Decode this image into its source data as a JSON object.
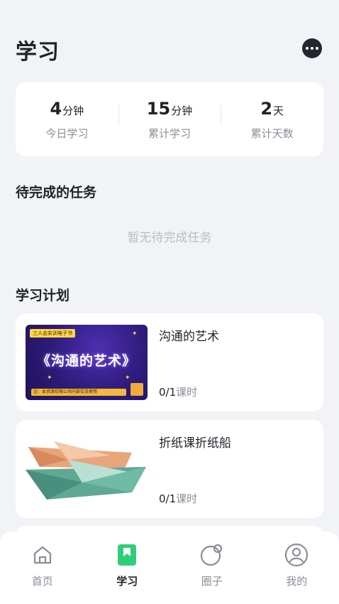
{
  "header": {
    "title": "学习"
  },
  "stats": [
    {
      "value": "4",
      "unit": "分钟",
      "label": "今日学习"
    },
    {
      "value": "15",
      "unit": "分钟",
      "label": "累计学习"
    },
    {
      "value": "2",
      "unit": "天",
      "label": "累计天数"
    }
  ],
  "tasks": {
    "title": "待完成的任务",
    "empty_text": "暂无待完成任务"
  },
  "plan": {
    "title": "学习计划",
    "courses": [
      {
        "title": "沟通的艺术",
        "progress": "0/1",
        "progress_unit": "课时",
        "thumb": {
          "tag": "三人会实训电子书",
          "name": "《沟通的艺术》",
          "bottom": "注：本资源仅限公司内部交流使用"
        }
      },
      {
        "title": "折纸课折纸船",
        "progress": "0/1",
        "progress_unit": "课时"
      }
    ]
  },
  "tabbar": {
    "items": [
      {
        "label": "首页",
        "icon": "home-icon",
        "active": false
      },
      {
        "label": "学习",
        "icon": "bookmark-icon",
        "active": true
      },
      {
        "label": "圈子",
        "icon": "circle-icon",
        "active": false
      },
      {
        "label": "我的",
        "icon": "user-icon",
        "active": false
      }
    ]
  },
  "colors": {
    "accent": "#2fcf7a",
    "background": "#f2f3f7",
    "thumb_purple": "#2d1a78"
  }
}
